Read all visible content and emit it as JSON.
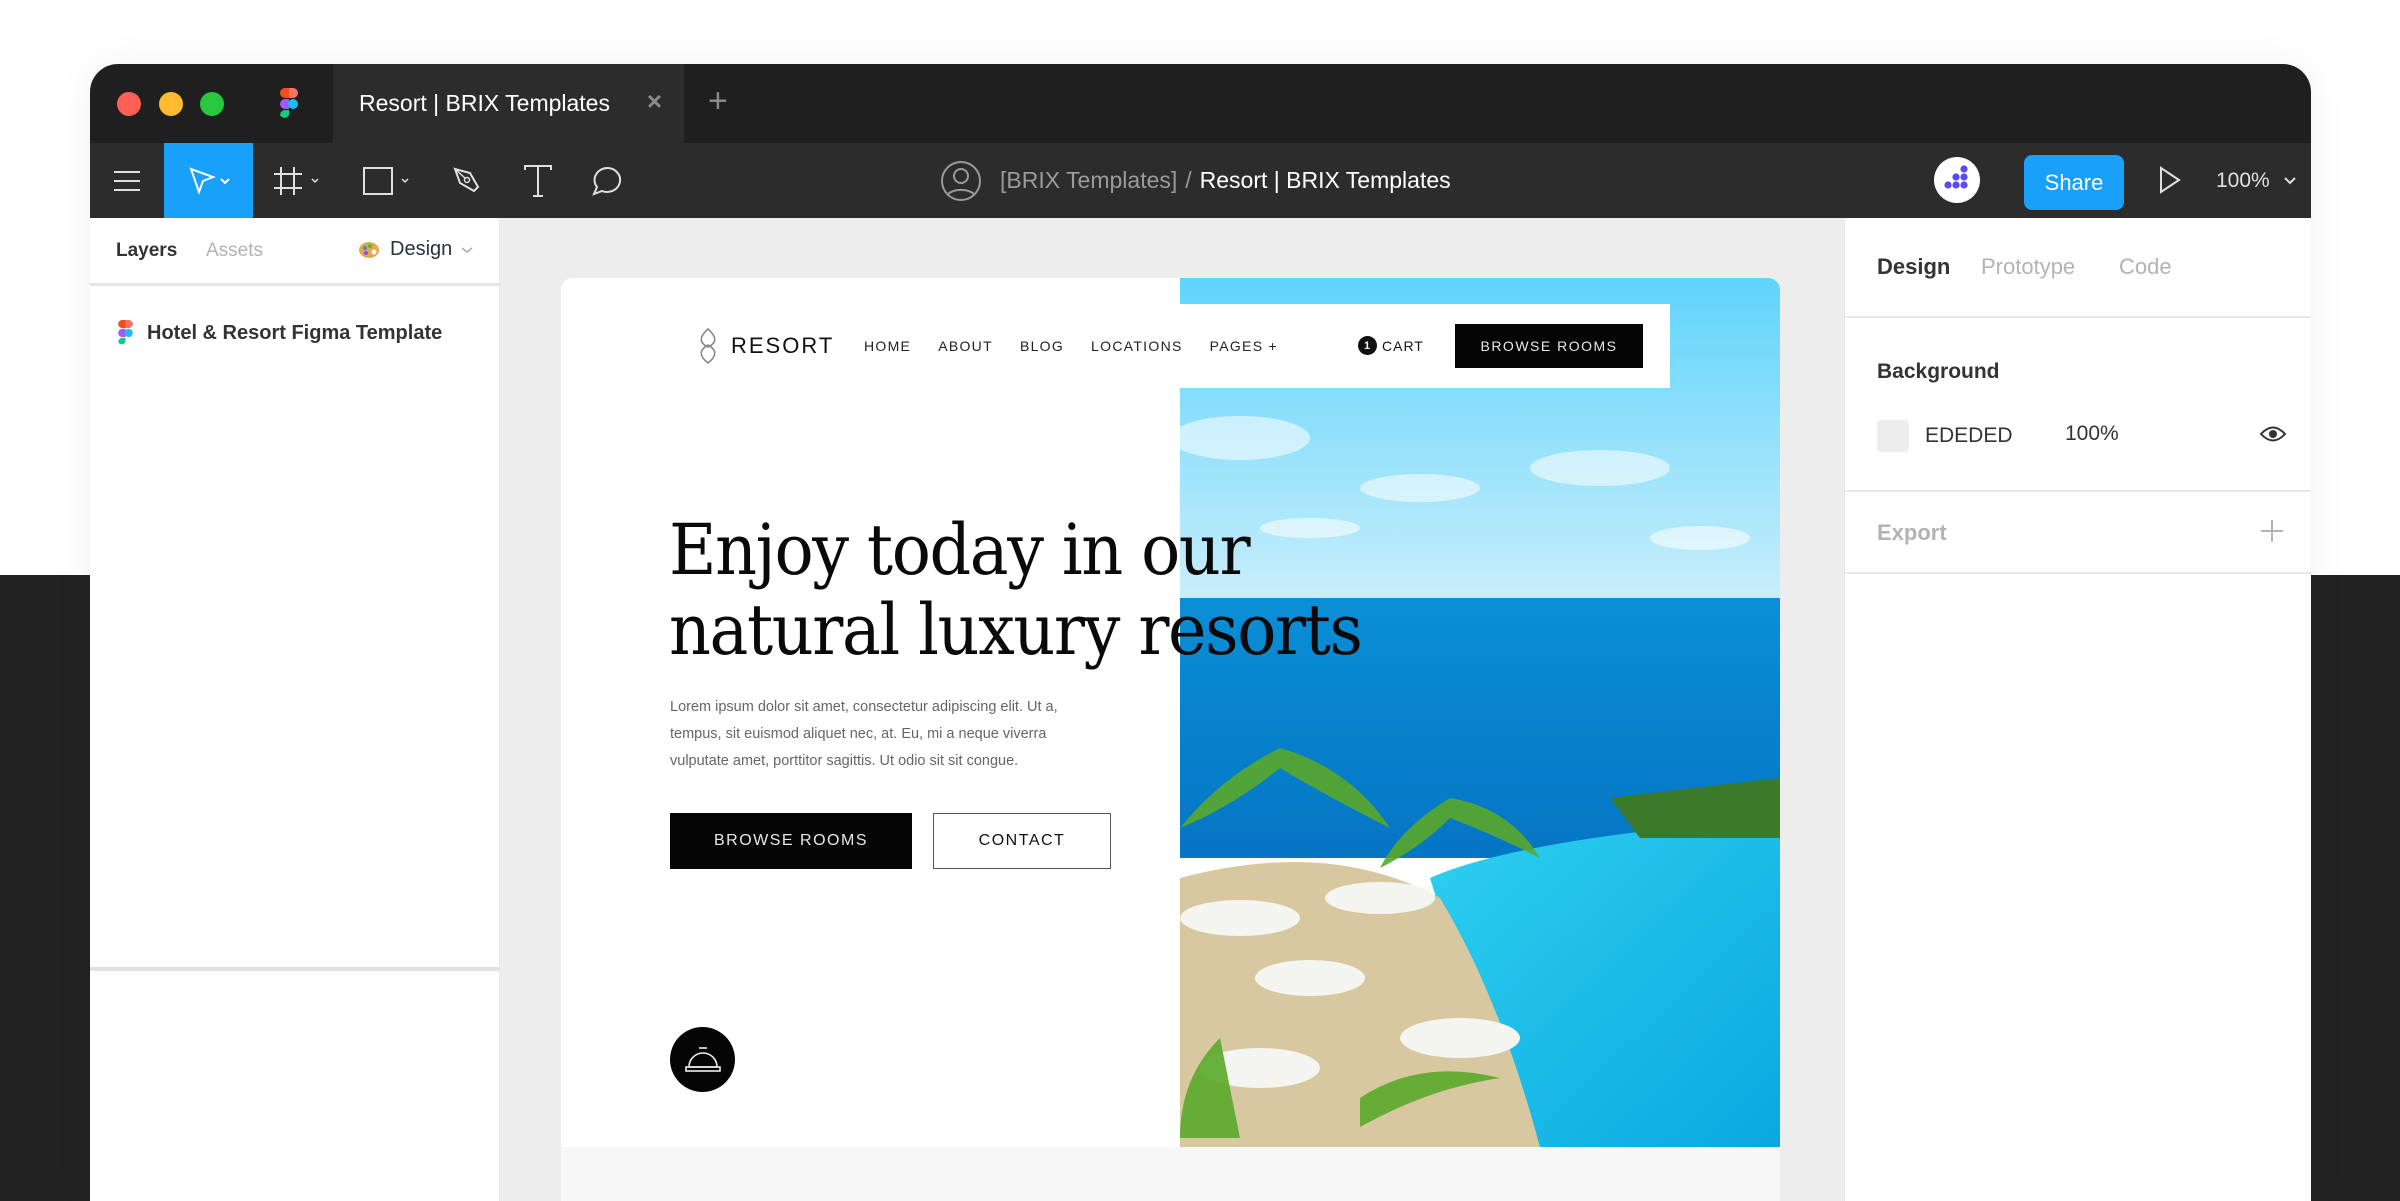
{
  "window": {
    "tab_title": "Resort | BRIX Templates",
    "tab_close_icon": "×",
    "tab_add_icon": "+"
  },
  "toolbar": {
    "tools": [
      {
        "name": "main-menu",
        "icon": "hamburger-icon"
      },
      {
        "name": "move-tool",
        "icon": "cursor-icon",
        "active": true
      },
      {
        "name": "frame-tool",
        "icon": "hash-frame-icon"
      },
      {
        "name": "shape-tool",
        "icon": "rectangle-icon"
      },
      {
        "name": "pen-tool",
        "icon": "pen-icon"
      },
      {
        "name": "text-tool",
        "icon": "text-icon"
      },
      {
        "name": "comment-tool",
        "icon": "comment-icon"
      }
    ],
    "path_team": "[BRIX Templates]",
    "path_separator": "/",
    "path_file": "Resort | BRIX Templates",
    "share_label": "Share",
    "zoom_level": "100%",
    "accent_color": "#18a0fb"
  },
  "left_panel": {
    "tab_layers": "Layers",
    "tab_assets": "Assets",
    "page_label": "Design",
    "layers": [
      {
        "name": "Hotel & Resort Figma Template"
      }
    ]
  },
  "right_panel": {
    "tab_design": "Design",
    "tab_prototype": "Prototype",
    "tab_code": "Code",
    "background_title": "Background",
    "background_hex": "EDEDED",
    "background_opacity": "100%",
    "export_title": "Export"
  },
  "site": {
    "brand": "RESORT",
    "nav": [
      "HOME",
      "ABOUT",
      "BLOG",
      "LOCATIONS",
      "PAGES +"
    ],
    "cart_count": "1",
    "cart_label": "CART",
    "nav_cta": "BROWSE ROOMS",
    "headline_line1": "Enjoy today in our",
    "headline_line2": "natural luxury resorts",
    "subtext": "Lorem ipsum dolor sit amet, consectetur adipiscing elit. Ut a, tempus, sit euismod aliquet nec, at. Eu, mi a neque viverra vulputate amet, porttitor sagittis. Ut odio sit sit congue.",
    "btn_primary": "BROWSE ROOMS",
    "btn_secondary": "CONTACT",
    "hero_image": "resort-pool-ocean-photo"
  }
}
